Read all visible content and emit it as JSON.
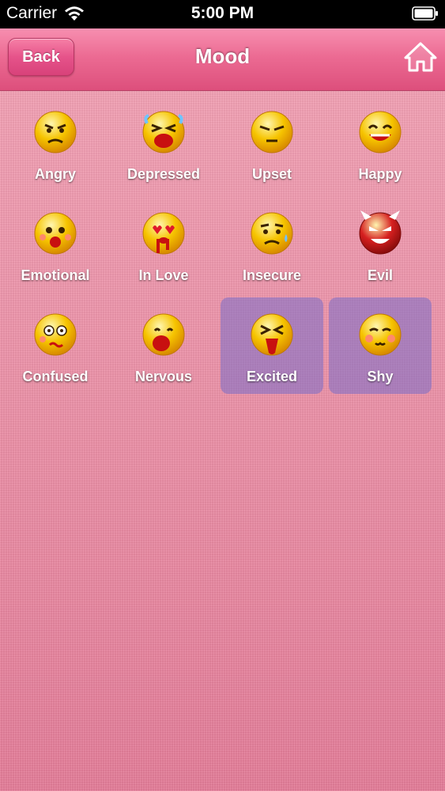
{
  "status_bar": {
    "carrier": "Carrier",
    "time": "5:00 PM"
  },
  "nav": {
    "back_label": "Back",
    "title": "Mood",
    "home_icon": "home-icon"
  },
  "moods": [
    {
      "label": "Angry",
      "icon": "angry-face-icon",
      "selected": false
    },
    {
      "label": "Depressed",
      "icon": "depressed-face-icon",
      "selected": false
    },
    {
      "label": "Upset",
      "icon": "upset-face-icon",
      "selected": false
    },
    {
      "label": "Happy",
      "icon": "happy-face-icon",
      "selected": false
    },
    {
      "label": "Emotional",
      "icon": "emotional-face-icon",
      "selected": false
    },
    {
      "label": "In Love",
      "icon": "in-love-face-icon",
      "selected": false
    },
    {
      "label": "Insecure",
      "icon": "insecure-face-icon",
      "selected": false
    },
    {
      "label": "Evil",
      "icon": "evil-face-icon",
      "selected": false
    },
    {
      "label": "Confused",
      "icon": "confused-face-icon",
      "selected": false
    },
    {
      "label": "Nervous",
      "icon": "nervous-face-icon",
      "selected": false
    },
    {
      "label": "Excited",
      "icon": "excited-face-icon",
      "selected": true
    },
    {
      "label": "Shy",
      "icon": "shy-face-icon",
      "selected": true
    }
  ],
  "colors": {
    "accent": "#e8557f",
    "selected_tile": "#8d80c6",
    "face_yellow": "#f6c400",
    "evil_red": "#d62020"
  }
}
